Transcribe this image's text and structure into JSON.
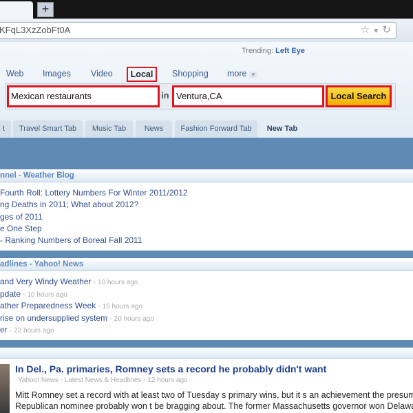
{
  "browser": {
    "new_tab_label": "+",
    "url": "KFqL3XzZobFt0A",
    "icons": [
      "star-icon",
      "dropdown-icon",
      "reload-icon"
    ]
  },
  "trending": {
    "label": "Trending:",
    "value": "Left Eye"
  },
  "search_nav": [
    {
      "label": "Web"
    },
    {
      "label": "Images"
    },
    {
      "label": "Video"
    },
    {
      "label": "Local",
      "active": true
    },
    {
      "label": "Shopping"
    },
    {
      "label": "more"
    }
  ],
  "search": {
    "query": "Mexican restaurants",
    "in_label": "in",
    "location": "Ventura,CA",
    "button": "Local Search",
    "highlight_color": "#e0141e"
  },
  "page_tabs": [
    "t",
    "Travel Smart Tab",
    "Music Tab",
    "News",
    "Fashion Forward Tab",
    "New Tab"
  ],
  "panel1": {
    "title": "nnel - Weather Blog",
    "items": [
      "Fourth Roll: Lottery Numbers For Winter 2011/2012",
      "ng Deaths in 2011; What about 2012?",
      "ges of 2011",
      "e One Step",
      "- Ranking Numbers of Boreal Fall 2011"
    ]
  },
  "panel2": {
    "title": "adlines - Yahoo! News",
    "items": [
      {
        "text": "and Very Windy Weather",
        "time": "- 10 hours ago"
      },
      {
        "text": "pdate",
        "time": "- 10 hours ago"
      },
      {
        "text": "ather Preparedness Week",
        "time": "- 15 hours ago"
      },
      {
        "text": "rise on undersupplied system",
        "time": "- 20 hours ago"
      },
      {
        "text": "er",
        "time": "- 22 hours ago"
      }
    ]
  },
  "article": {
    "title": "In Del., Pa. primaries, Romney sets a record he probably didn't want",
    "source": "Yahoo! News - Latest News & Headlines - 12 hours ago",
    "lines": [
      "Mitt Romney set a record with at least two of Tuesday s primary wins, but it s an achievement the presump",
      "Republican nominee probably won t be bragging about. The former Massachusetts governor won Delaware w"
    ]
  }
}
